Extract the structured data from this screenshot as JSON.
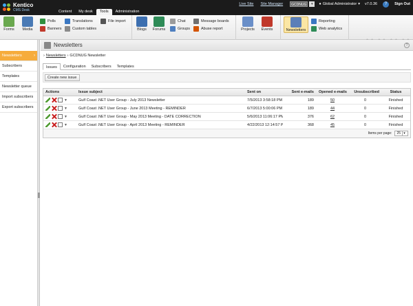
{
  "app": {
    "logo_title": "Kentico",
    "logo_subtitle": "CMS Desk",
    "main_tabs": [
      {
        "label": "Content",
        "active": false
      },
      {
        "label": "My desk",
        "active": false
      },
      {
        "label": "Tools",
        "active": true
      },
      {
        "label": "Administration",
        "active": false
      }
    ],
    "top_links": {
      "live_site": "Live Site",
      "site_manager": "Site Manager"
    },
    "site_selector": "GCDNUG",
    "user": "Global Administrator",
    "version": "v7.0.36",
    "sign_out": "Sign Out"
  },
  "ribbon": {
    "groups": "Groups",
    "forms": "Forms",
    "media": "Media",
    "polls": "Polls",
    "banners": "Banners",
    "translations": "Translations",
    "custom_tables": "Custom tables",
    "file_import": "File import",
    "blogs": "Blogs",
    "forums": "Forums",
    "chat": "Chat",
    "message_boards": "Message boards",
    "abuse_report": "Abuse report",
    "projects": "Projects",
    "events": "Events",
    "newsletters": "Newsletters",
    "reporting": "Reporting",
    "web_analytics": "Web analytics"
  },
  "sidebar": {
    "items": [
      {
        "label": "Newsletters",
        "active": true
      },
      {
        "label": "Subscribers",
        "active": false
      },
      {
        "label": "Templates",
        "active": false
      },
      {
        "label": "Newsletter queue",
        "active": false
      },
      {
        "label": "Import subscribers",
        "active": false
      },
      {
        "label": "Export subscribers",
        "active": false
      }
    ]
  },
  "page": {
    "title": "Newsletters",
    "help": "?",
    "breadcrumb": {
      "link": "Newsletters",
      "current": "GCDNUG Newsletter"
    },
    "tabs": [
      {
        "label": "Issues",
        "active": true
      },
      {
        "label": "Configuration",
        "active": false
      },
      {
        "label": "Subscribers",
        "active": false
      },
      {
        "label": "Templates",
        "active": false
      }
    ],
    "create_button": "Create new issue"
  },
  "grid": {
    "columns": {
      "actions": "Actions",
      "subject": "Issue subject",
      "sent_on": "Sent on",
      "sent_emails": "Sent e-mails",
      "opened_emails": "Opened e-mails",
      "unsubscribed": "Unsubscribed",
      "status": "Status"
    },
    "rows": [
      {
        "subject": "Gulf Coast .NET User Group - July 2013 Newsletter",
        "sent_on": "7/5/2013 3:58:18 PM",
        "sent_emails": "189",
        "opened_emails": "50",
        "unsubscribed": "0",
        "status": "Finished"
      },
      {
        "subject": "Gulf Coast .NET User Group - June 2013 Meeting - REMINDER",
        "sent_on": "6/7/2013 5:00:06 PM",
        "sent_emails": "189",
        "opened_emails": "44",
        "unsubscribed": "0",
        "status": "Finished"
      },
      {
        "subject": "Gulf Coast .NET User Group - May 2013 Meeting - DATE CORRECTION",
        "sent_on": "5/6/2013 11:06:17 PM",
        "sent_emails": "376",
        "opened_emails": "62",
        "unsubscribed": "0",
        "status": "Finished"
      },
      {
        "subject": "Gulf Coast .NET User Group - April 2013 Meeting - REMINDER",
        "sent_on": "4/22/2013 12:14:57 PM",
        "sent_emails": "368",
        "opened_emails": "45",
        "unsubscribed": "0",
        "status": "Finished"
      }
    ],
    "items_per_page_label": "Items per page:",
    "items_per_page": "25"
  },
  "colors": {
    "accent_orange": "#f6ac3c",
    "topbar": "#1b1b1b",
    "link_blue": "#cfe3f7"
  }
}
